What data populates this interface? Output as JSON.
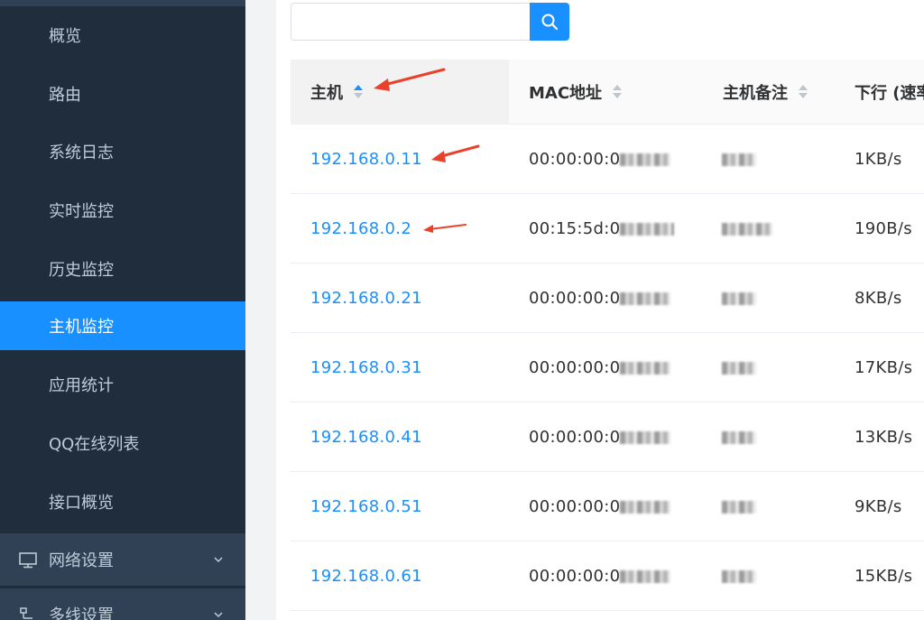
{
  "sidebar": {
    "items": [
      {
        "label": "概览",
        "active": false
      },
      {
        "label": "路由",
        "active": false
      },
      {
        "label": "系统日志",
        "active": false
      },
      {
        "label": "实时监控",
        "active": false
      },
      {
        "label": "历史监控",
        "active": false
      },
      {
        "label": "主机监控",
        "active": true
      },
      {
        "label": "应用统计",
        "active": false
      },
      {
        "label": "QQ在线列表",
        "active": false
      },
      {
        "label": "接口概览",
        "active": false
      }
    ],
    "groups": [
      {
        "label": "网络设置",
        "icon": "monitor-icon"
      },
      {
        "label": "多线设置",
        "icon": "network-icon"
      }
    ],
    "colors": {
      "bg": "#1f2d3d",
      "group_bg": "#304156",
      "active": "#1890ff",
      "text": "#bfcbd9"
    }
  },
  "search": {
    "value": "",
    "placeholder": "",
    "icon": "search-icon"
  },
  "table": {
    "columns": [
      {
        "label": "主机",
        "sort": "asc"
      },
      {
        "label": "MAC地址",
        "sort": "none"
      },
      {
        "label": "主机备注",
        "sort": "none"
      },
      {
        "label": "下行 (速率"
      }
    ],
    "rows": [
      {
        "host": "192.168.0.11",
        "mac": "00:00:00:0",
        "down": "1KB/s"
      },
      {
        "host": "192.168.0.2",
        "mac": "00:15:5d:0",
        "down": "190B/s"
      },
      {
        "host": "192.168.0.21",
        "mac": "00:00:00:0",
        "down": "8KB/s"
      },
      {
        "host": "192.168.0.31",
        "mac": "00:00:00:0",
        "down": "17KB/s"
      },
      {
        "host": "192.168.0.41",
        "mac": "00:00:00:0",
        "down": "13KB/s"
      },
      {
        "host": "192.168.0.51",
        "mac": "00:00:00:0",
        "down": "9KB/s"
      },
      {
        "host": "192.168.0.61",
        "mac": "00:00:00:0",
        "down": "15KB/s"
      }
    ]
  },
  "annotations": {
    "arrow_color": "#e8412c"
  }
}
